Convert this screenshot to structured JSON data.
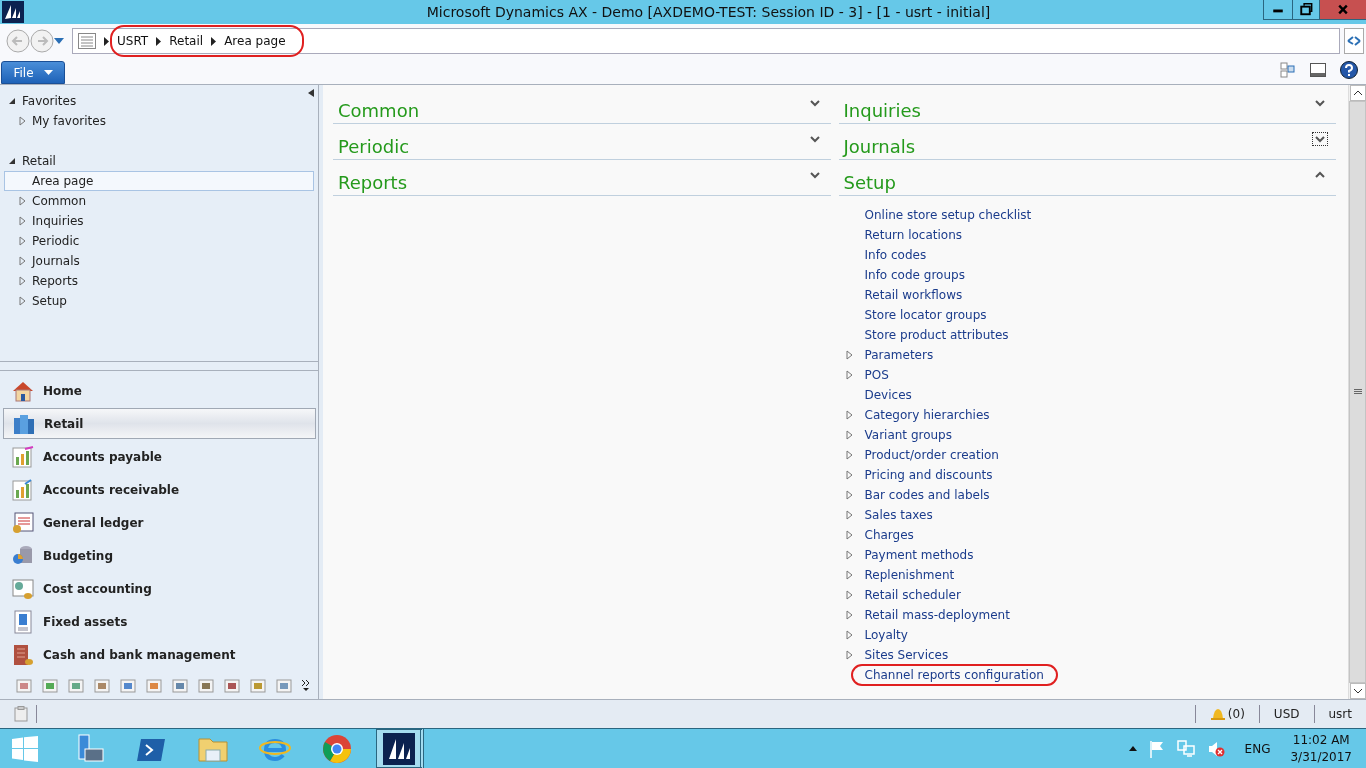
{
  "window": {
    "title": "Microsoft Dynamics AX - Demo [AXDEMO-TEST: Session ID - 3] -  [1 - usrt - initial]"
  },
  "address_bar": {
    "breadcrumb": [
      "USRT",
      "Retail",
      "Area page"
    ]
  },
  "file_menu": {
    "label": "File"
  },
  "nav_tree": [
    {
      "label": "Favorites",
      "expanded": true,
      "children": [
        {
          "label": "My favorites",
          "expandable": true,
          "selected": false
        }
      ]
    },
    {
      "label": "Retail",
      "expanded": true,
      "children": [
        {
          "label": "Area page",
          "expandable": false,
          "selected": true
        },
        {
          "label": "Common",
          "expandable": true,
          "selected": false
        },
        {
          "label": "Inquiries",
          "expandable": true,
          "selected": false
        },
        {
          "label": "Periodic",
          "expandable": true,
          "selected": false
        },
        {
          "label": "Journals",
          "expandable": true,
          "selected": false
        },
        {
          "label": "Reports",
          "expandable": true,
          "selected": false
        },
        {
          "label": "Setup",
          "expandable": true,
          "selected": false
        }
      ]
    }
  ],
  "modules": [
    {
      "label": "Home",
      "selected": false
    },
    {
      "label": "Retail",
      "selected": true
    },
    {
      "label": "Accounts payable",
      "selected": false
    },
    {
      "label": "Accounts receivable",
      "selected": false
    },
    {
      "label": "General ledger",
      "selected": false
    },
    {
      "label": "Budgeting",
      "selected": false
    },
    {
      "label": "Cost accounting",
      "selected": false
    },
    {
      "label": "Fixed assets",
      "selected": false
    },
    {
      "label": "Cash and bank management",
      "selected": false
    }
  ],
  "content": {
    "left_groups": [
      {
        "title": "Common",
        "expanded": false,
        "focused": false
      },
      {
        "title": "Periodic",
        "expanded": false,
        "focused": false
      },
      {
        "title": "Reports",
        "expanded": false,
        "focused": false
      }
    ],
    "right_groups": [
      {
        "title": "Inquiries",
        "expanded": false,
        "focused": false
      },
      {
        "title": "Journals",
        "expanded": false,
        "focused": true
      },
      {
        "title": "Setup",
        "expanded": true,
        "focused": false,
        "links": [
          {
            "label": "Online store setup checklist",
            "expandable": false,
            "highlighted": false
          },
          {
            "label": "Return locations",
            "expandable": false,
            "highlighted": false
          },
          {
            "label": "Info codes",
            "expandable": false,
            "highlighted": false
          },
          {
            "label": "Info code groups",
            "expandable": false,
            "highlighted": false
          },
          {
            "label": "Retail workflows",
            "expandable": false,
            "highlighted": false
          },
          {
            "label": "Store locator groups",
            "expandable": false,
            "highlighted": false
          },
          {
            "label": "Store product attributes",
            "expandable": false,
            "highlighted": false
          },
          {
            "label": "Parameters",
            "expandable": true,
            "highlighted": false
          },
          {
            "label": "POS",
            "expandable": true,
            "highlighted": false
          },
          {
            "label": "Devices",
            "expandable": false,
            "highlighted": false
          },
          {
            "label": "Category hierarchies",
            "expandable": true,
            "highlighted": false
          },
          {
            "label": "Variant groups",
            "expandable": true,
            "highlighted": false
          },
          {
            "label": "Product/order creation",
            "expandable": true,
            "highlighted": false
          },
          {
            "label": "Pricing and discounts",
            "expandable": true,
            "highlighted": false
          },
          {
            "label": "Bar codes and labels",
            "expandable": true,
            "highlighted": false
          },
          {
            "label": "Sales taxes",
            "expandable": true,
            "highlighted": false
          },
          {
            "label": "Charges",
            "expandable": true,
            "highlighted": false
          },
          {
            "label": "Payment methods",
            "expandable": true,
            "highlighted": false
          },
          {
            "label": "Replenishment",
            "expandable": true,
            "highlighted": false
          },
          {
            "label": "Retail scheduler",
            "expandable": true,
            "highlighted": false
          },
          {
            "label": "Retail mass-deployment",
            "expandable": true,
            "highlighted": false
          },
          {
            "label": "Loyalty",
            "expandable": true,
            "highlighted": false
          },
          {
            "label": "Sites Services",
            "expandable": true,
            "highlighted": false
          },
          {
            "label": "Channel reports configuration",
            "expandable": false,
            "highlighted": true
          }
        ]
      }
    ]
  },
  "status_bar": {
    "notifications": "(0)",
    "currency": "USD",
    "user": "usrt"
  },
  "taskbar": {
    "apps": [
      {
        "active": false
      },
      {
        "active": false
      },
      {
        "active": false
      },
      {
        "active": false
      },
      {
        "active": false
      },
      {
        "active": true
      }
    ],
    "language": "ENG",
    "time": "11:02 AM",
    "date": "3/31/2017"
  }
}
